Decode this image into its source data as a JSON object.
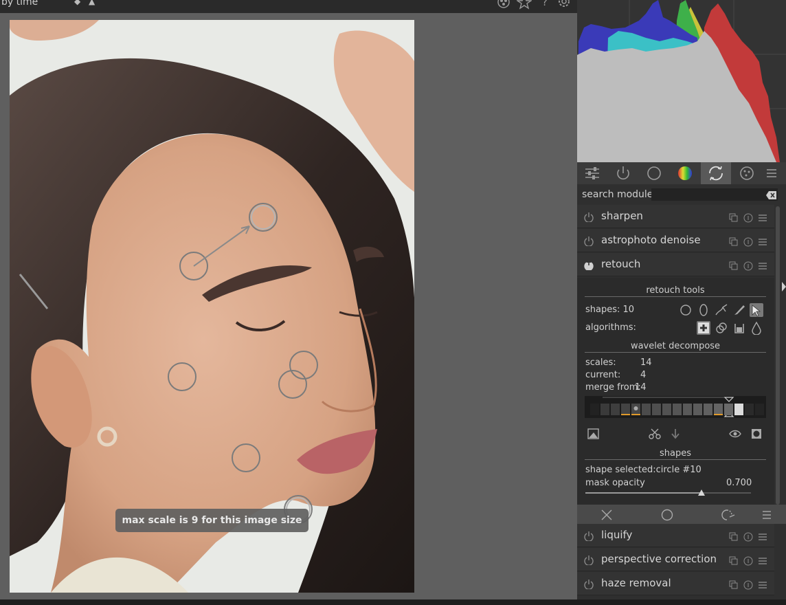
{
  "topbar": {
    "sort_label": "by  time",
    "sort_arrows": "◆ ▲",
    "icons": [
      "color-labels-icon",
      "star-icon",
      "help-icon",
      "gear-icon"
    ]
  },
  "image": {
    "toast": "max scale is 9 for this image size"
  },
  "panel": {
    "module_groups": [
      "quick-access-icon",
      "active-modules-icon",
      "base-modules-icon",
      "color-modules-icon",
      "correct-modules-icon",
      "effect-modules-icon",
      "presets-menu-icon"
    ],
    "search": {
      "label": "search module",
      "placeholder": ""
    },
    "modules_top": [
      {
        "label": "sharpen"
      },
      {
        "label": "astrophoto denoise"
      },
      {
        "label": "retouch",
        "enabled": true
      }
    ],
    "retouch": {
      "tools_header": "retouch tools",
      "shapes_label": "shapes: 10",
      "algorithms_label": "algorithms:",
      "wavelet_header": "wavelet decompose",
      "scales_label": "scales:",
      "scales_value": "14",
      "current_label": "current:",
      "current_value": "4",
      "merge_label": "merge from:",
      "merge_value": "14",
      "shapes_header": "shapes",
      "shape_selected": "shape selected:circle #10",
      "mask_opacity_label": "mask opacity",
      "mask_opacity_value": "0.700",
      "mask_opacity_fraction": 0.7
    },
    "modules_bottom": [
      {
        "label": "liquify"
      },
      {
        "label": "perspective correction"
      },
      {
        "label": "haze removal"
      }
    ]
  }
}
